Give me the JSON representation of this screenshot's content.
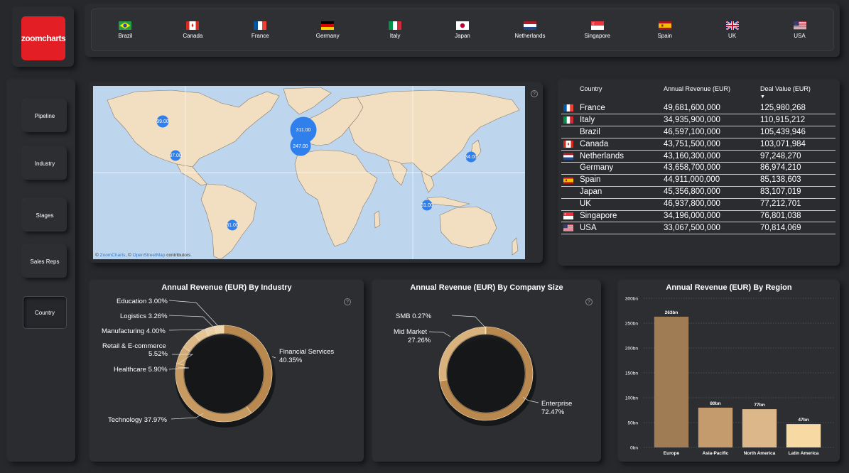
{
  "logo_text": "zoomcharts",
  "countries": [
    {
      "name": "Brazil",
      "flag": "brazil"
    },
    {
      "name": "Canada",
      "flag": "canada"
    },
    {
      "name": "France",
      "flag": "france"
    },
    {
      "name": "Germany",
      "flag": "germany"
    },
    {
      "name": "Italy",
      "flag": "italy"
    },
    {
      "name": "Japan",
      "flag": "japan"
    },
    {
      "name": "Netherlands",
      "flag": "netherlands"
    },
    {
      "name": "Singapore",
      "flag": "singapore"
    },
    {
      "name": "Spain",
      "flag": "spain"
    },
    {
      "name": "UK",
      "flag": "uk"
    },
    {
      "name": "USA",
      "flag": "usa"
    }
  ],
  "nav": [
    "Pipeline",
    "Industry",
    "Stages",
    "Sales Reps",
    "Country"
  ],
  "nav_active": "Country",
  "map": {
    "bubbles": [
      "99.00",
      "37.00",
      "311.00",
      "247.00",
      "34.00",
      "31.00",
      "31.00"
    ],
    "attribution_prefix": "© ",
    "attribution_link1": "ZoomCharts",
    "attribution_mid": ", © ",
    "attribution_link2": "OpenStreetMap",
    "attribution_suffix": " contributors",
    "colors": {
      "water": "#bdd6ee",
      "land": "#f2dfc2",
      "bubble": "#2f80ed"
    }
  },
  "table": {
    "headers": {
      "country": "Country",
      "revenue": "Annual Revenue (EUR)",
      "deal": "Deal Value (EUR)"
    },
    "sort_icon": "sort-desc-icon",
    "rows": [
      {
        "country": "France",
        "flag": "france",
        "revenue": "49,681,600,000",
        "deal": "125,980,268"
      },
      {
        "country": "Italy",
        "flag": "italy",
        "revenue": "34,935,900,000",
        "deal": "110,915,212"
      },
      {
        "country": "Brazil",
        "flag": "",
        "revenue": "46,597,100,000",
        "deal": "105,439,946"
      },
      {
        "country": "Canada",
        "flag": "canada",
        "revenue": "43,751,500,000",
        "deal": "103,071,984"
      },
      {
        "country": "Netherlands",
        "flag": "netherlands",
        "revenue": "43,160,300,000",
        "deal": "97,248,270"
      },
      {
        "country": "Germany",
        "flag": "",
        "revenue": "43,658,700,000",
        "deal": "86,974,210"
      },
      {
        "country": "Spain",
        "flag": "spain",
        "revenue": "44,911,000,000",
        "deal": "85,138,603"
      },
      {
        "country": "Japan",
        "flag": "",
        "revenue": "45,356,800,000",
        "deal": "83,107,019"
      },
      {
        "country": "UK",
        "flag": "",
        "revenue": "46,937,800,000",
        "deal": "77,212,701"
      },
      {
        "country": "Singapore",
        "flag": "singapore",
        "revenue": "34,196,000,000",
        "deal": "76,801,038"
      },
      {
        "country": "USA",
        "flag": "usa",
        "revenue": "33,067,500,000",
        "deal": "70,814,069"
      }
    ]
  },
  "industry_chart": {
    "title": "Annual Revenue (EUR) By Industry",
    "labels": {
      "education": "Education 3.00%",
      "logistics": "Logistics 3.26%",
      "manufacturing": "Manufacturing 4.00%",
      "retail_1": "Retail & E-commerce",
      "retail_2": "5.52%",
      "healthcare": "Healthcare 5.90%",
      "technology": "Technology 37.97%",
      "financial_1": "Financial Services",
      "financial_2": "40.35%"
    }
  },
  "size_chart": {
    "title": "Annual Revenue (EUR) By Company Size",
    "labels": {
      "smb": "SMB 0.27%",
      "mid_1": "Mid Market",
      "mid_2": "27.26%",
      "ent_1": "Enterprise",
      "ent_2": "72.47%"
    }
  },
  "region_chart": {
    "title": "Annual Revenue (EUR) By Region",
    "y_ticks": [
      "0bn",
      "50bn",
      "100bn",
      "150bn",
      "200bn",
      "250bn",
      "300bn"
    ]
  },
  "chart_data": [
    {
      "type": "pie",
      "title": "Annual Revenue (EUR) By Industry",
      "categories": [
        "Financial Services",
        "Technology",
        "Healthcare",
        "Retail & E-commerce",
        "Manufacturing",
        "Logistics",
        "Education"
      ],
      "values": [
        40.35,
        37.97,
        5.9,
        5.52,
        4.0,
        3.26,
        3.0
      ],
      "colors": [
        "#b8884f",
        "#c79a62",
        "#d2ab74",
        "#dcb886",
        "#e3c596",
        "#e9cfa4",
        "#efd8b0"
      ]
    },
    {
      "type": "pie",
      "title": "Annual Revenue (EUR) By Company Size",
      "categories": [
        "Enterprise",
        "Mid Market",
        "SMB"
      ],
      "values": [
        72.47,
        27.26,
        0.27
      ],
      "colors": [
        "#b8884f",
        "#d9b27e",
        "#efd8b0"
      ]
    },
    {
      "type": "bar",
      "title": "Annual Revenue (EUR) By Region",
      "categories": [
        "Europe",
        "Asia-Pacific",
        "North America",
        "Latin America"
      ],
      "values": [
        263,
        80,
        77,
        47
      ],
      "data_labels": [
        "263bn",
        "80bn",
        "77bn",
        "47bn"
      ],
      "ylim": [
        0,
        300
      ],
      "grid": true,
      "colors": [
        "#a07c55",
        "#c49b6c",
        "#dcb78a",
        "#f6d9a3"
      ]
    }
  ]
}
